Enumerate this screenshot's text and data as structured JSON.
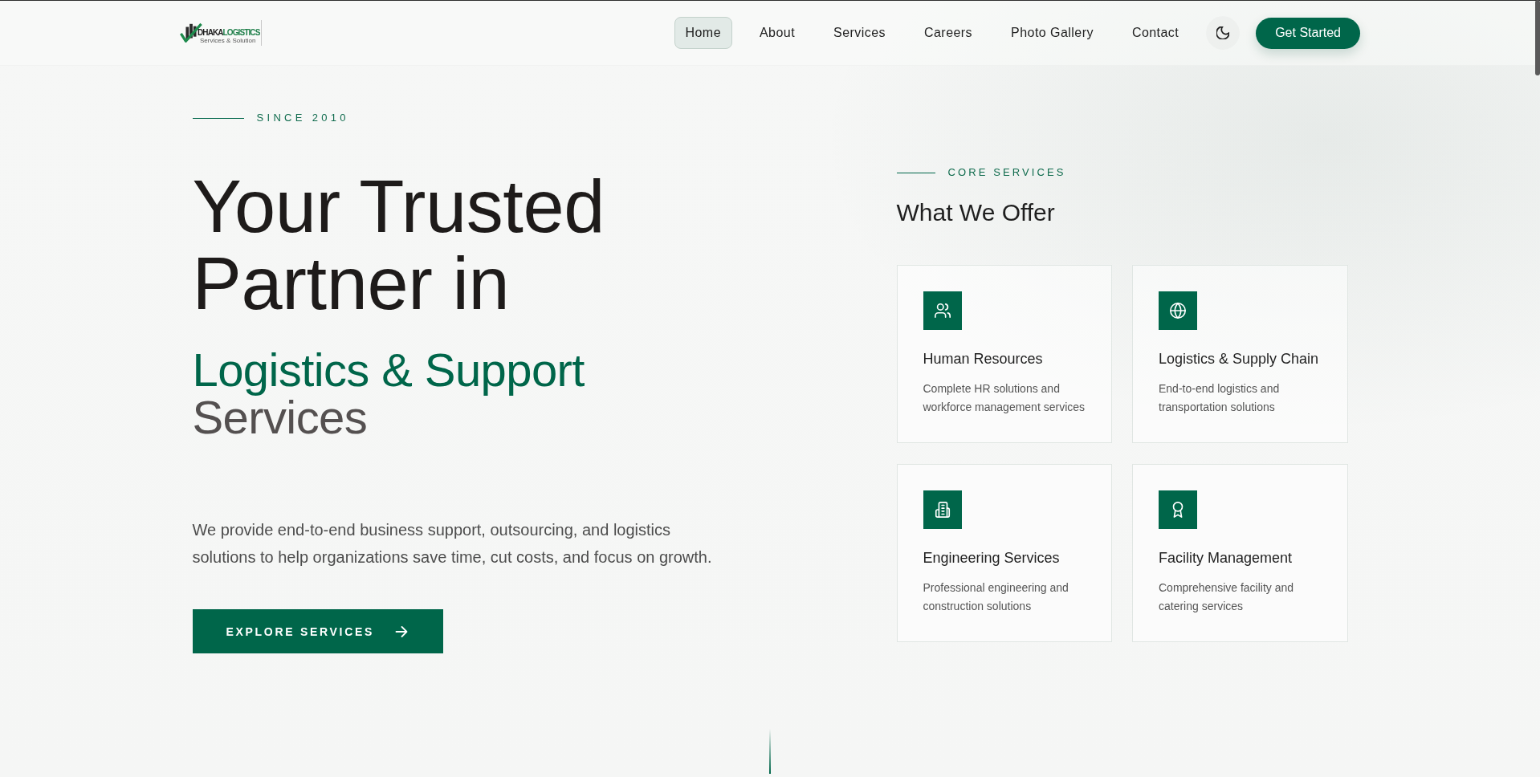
{
  "header": {
    "logo": {
      "name_dark": "DHAKA",
      "name_accent": "LOGISTICS",
      "tagline": "Services & Solution"
    },
    "nav": [
      {
        "label": "Home",
        "selected": true
      },
      {
        "label": "About",
        "selected": false
      },
      {
        "label": "Services",
        "selected": false
      },
      {
        "label": "Careers",
        "selected": false
      },
      {
        "label": "Photo Gallery",
        "selected": false
      },
      {
        "label": "Contact",
        "selected": false
      }
    ],
    "cta": "Get Started"
  },
  "hero": {
    "eyebrow": "SINCE 2010",
    "heading_lines": [
      "Your Trusted",
      "Partner in"
    ],
    "heading_accent": "Logistics & Support",
    "heading_end": "Services",
    "description": "We provide end-to-end business support, outsourcing, and logistics solutions to help organizations save time, cut costs, and focus on growth.",
    "button": "EXPLORE SERVICES"
  },
  "services": {
    "eyebrow": "CORE SERVICES",
    "title": "What We Offer",
    "items": [
      {
        "kind": "people",
        "title": "Human Resources",
        "description": "Complete HR solutions and workforce management services"
      },
      {
        "kind": "globe",
        "title": "Logistics & Supply Chain",
        "description": "End-to-end logistics and transportation solutions"
      },
      {
        "kind": "building",
        "title": "Engineering Services",
        "description": "Professional engineering and construction solutions"
      },
      {
        "kind": "medal",
        "title": "Facility Management",
        "description": "Comprehensive facility and catering services"
      }
    ]
  }
}
